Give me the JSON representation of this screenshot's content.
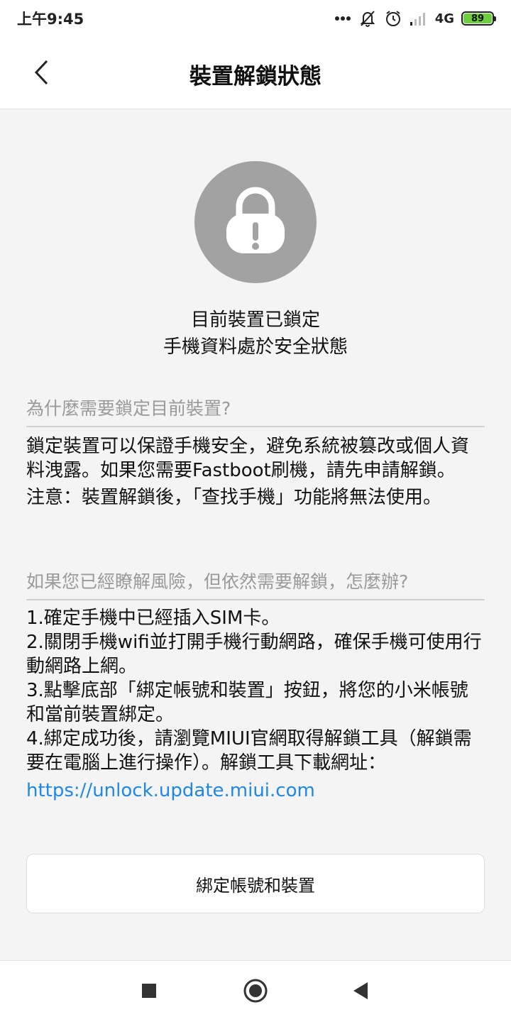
{
  "status_bar": {
    "time": "上午9:45",
    "network": "4G",
    "battery": "89",
    "icons": [
      "more-dots-icon",
      "mute-bell-icon",
      "alarm-icon",
      "signal-icon",
      "4g-icon",
      "battery-icon"
    ]
  },
  "header": {
    "title": "裝置解鎖狀態",
    "back_icon": "chevron-left-icon"
  },
  "lock": {
    "icon": "lock-warning-icon",
    "lines": [
      "目前裝置已鎖定",
      "手機資料處於安全狀態"
    ]
  },
  "why_section": {
    "title": "為什麼需要鎖定目前裝置?",
    "paragraph1": "鎖定裝置可以保證手機安全，避免系統被篡改或個人資料洩露。如果您需要Fastboot刷機，請先申請解鎖。",
    "paragraph2": "注意：裝置解鎖後，「查找手機」功能將無法使用。"
  },
  "how_section": {
    "title": "如果您已經瞭解風險，但依然需要解鎖，怎麼辦?",
    "steps": [
      "1.確定手機中已經插入SIM卡。",
      "2.關閉手機wifi並打開手機行動網路，確保手機可使用行動網路上網。",
      "3.點擊底部「綁定帳號和裝置」按鈕，將您的小米帳號和當前裝置綁定。",
      "4.綁定成功後，請瀏覽MIUI官網取得解鎖工具（解鎖需要在電腦上進行操作）。解鎖工具下載網址："
    ],
    "link": "https://unlock.update.miui.com"
  },
  "bind_button": {
    "label": "綁定帳號和裝置"
  },
  "nav_bar": {
    "recents_icon": "square-icon",
    "home_icon": "circle-icon",
    "back_icon": "triangle-back-icon"
  },
  "colors": {
    "link": "#1e88e5",
    "lock_circle": "#a2a2a2",
    "battery": "#6ecf3c",
    "background": "#f4f4f4"
  }
}
